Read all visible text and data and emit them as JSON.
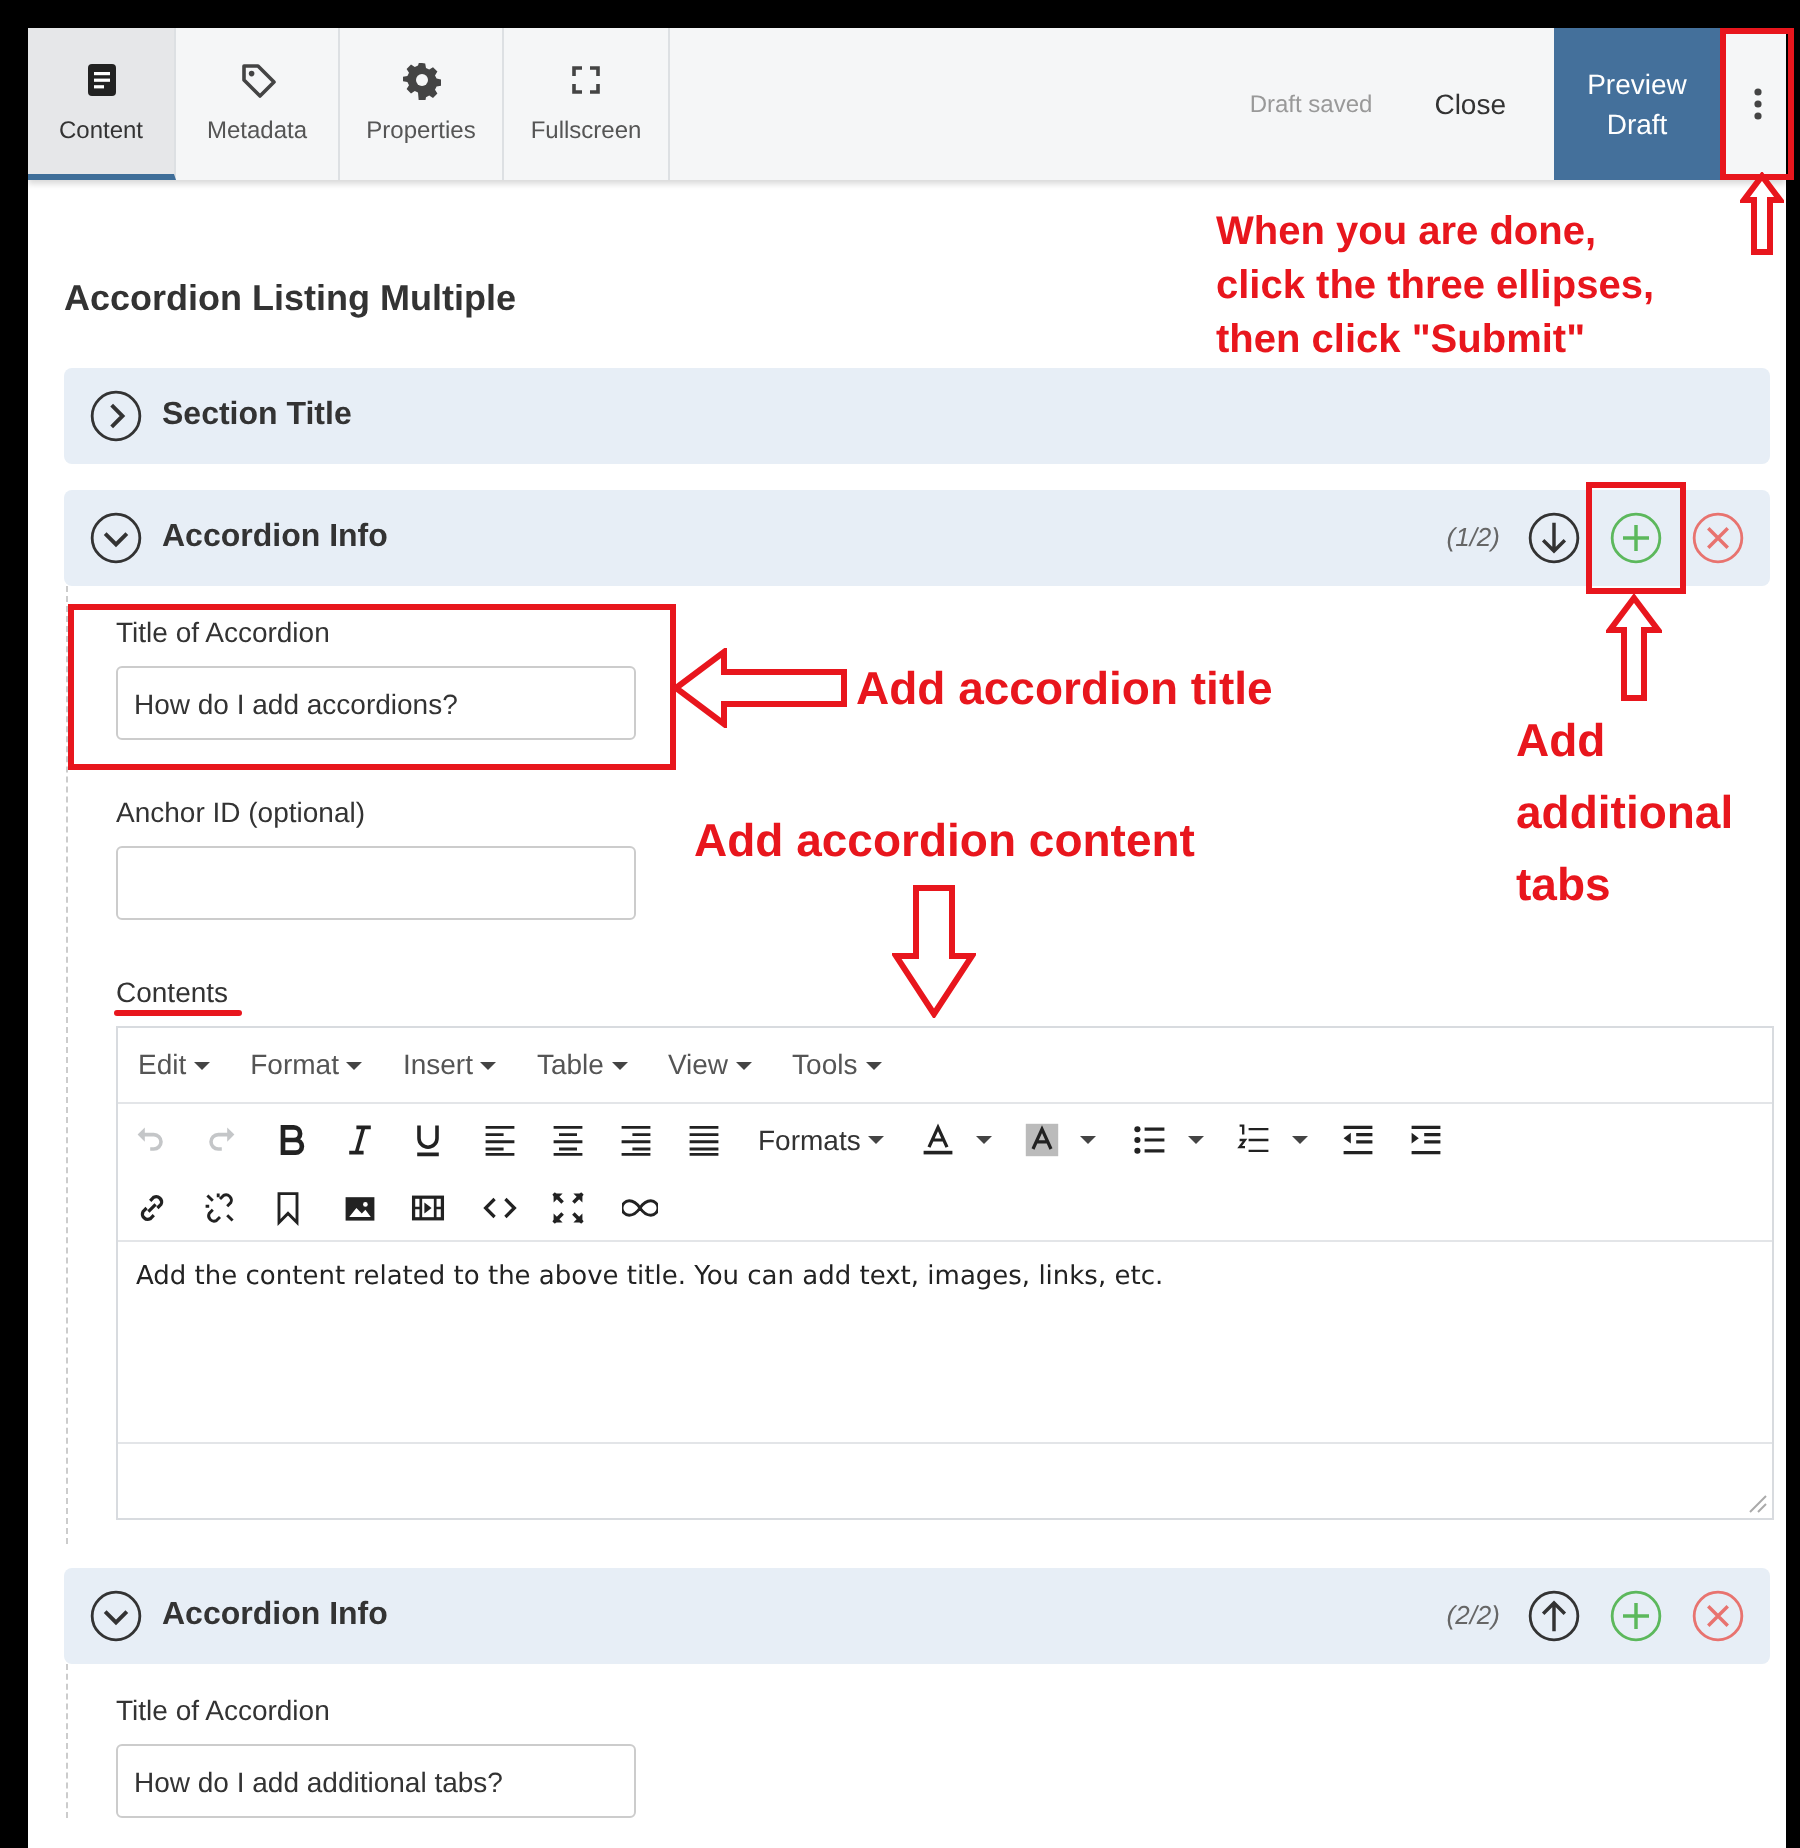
{
  "header": {
    "tabs": [
      {
        "label": "Content",
        "selected": true
      },
      {
        "label": "Metadata",
        "selected": false
      },
      {
        "label": "Properties",
        "selected": false
      },
      {
        "label": "Fullscreen",
        "selected": false
      }
    ],
    "status": "Draft saved",
    "close": "Close",
    "preview": "Preview Draft"
  },
  "page_title": "Accordion Listing Multiple",
  "sections": [
    {
      "title": "Section Title",
      "expanded": false
    },
    {
      "title": "Accordion Info",
      "expanded": true,
      "counter": "(1/2)",
      "move_down": true,
      "fields": [
        {
          "kind": "input",
          "label": "Title of Accordion",
          "value": "How do I add accordions?"
        },
        {
          "kind": "input",
          "label": "Anchor ID (optional)"
        },
        {
          "kind": "editor",
          "label": "Contents"
        }
      ]
    },
    {
      "title": "Accordion Info",
      "expanded": true,
      "counter": "(2/2)",
      "move_down": false,
      "fields": [
        {
          "kind": "input",
          "label": "Title of Accordion",
          "value": "How do I add additional tabs?"
        }
      ]
    }
  ],
  "editor": {
    "menus": [
      "Edit",
      "Format",
      "Insert",
      "Table",
      "View",
      "Tools"
    ],
    "toolbar_rows": [
      [
        [
          {
            "kind": "button",
            "disabled": true
          },
          {
            "kind": "button",
            "disabled": true
          }
        ],
        [
          {
            "kind": "button",
            "disabled": false
          },
          {
            "kind": "button",
            "disabled": false
          },
          {
            "kind": "button",
            "disabled": false
          }
        ],
        [
          {
            "kind": "button",
            "disabled": false
          },
          {
            "kind": "button",
            "disabled": false
          },
          {
            "kind": "button",
            "disabled": false
          },
          {
            "kind": "button",
            "disabled": false
          }
        ],
        [
          {
            "kind": "dropdown",
            "label": "Formats"
          }
        ],
        [
          {
            "kind": "split",
            "disabled": false
          },
          {
            "kind": "split",
            "disabled": false
          }
        ],
        [
          {
            "kind": "split",
            "disabled": false
          },
          {
            "kind": "split",
            "disabled": false
          },
          {
            "kind": "button",
            "disabled": false
          },
          {
            "kind": "button",
            "disabled": false
          }
        ]
      ],
      [
        [
          {
            "kind": "button",
            "disabled": false
          },
          {
            "kind": "button",
            "disabled": false
          },
          {
            "kind": "button",
            "disabled": false
          }
        ],
        [
          {
            "kind": "button",
            "disabled": false
          },
          {
            "kind": "button",
            "disabled": false
          }
        ],
        [
          {
            "kind": "button",
            "disabled": false
          },
          {
            "kind": "button",
            "disabled": false
          }
        ],
        [
          {
            "kind": "button",
            "disabled": false
          }
        ]
      ]
    ],
    "content": "Add the content related to the above title. You can add text, images, links, etc."
  },
  "annotations": [
    {
      "text": "When you are done, click the three ellipses, then click \"Submit\""
    },
    {
      "text": "Add accordion title"
    },
    {
      "text": "Add additional tabs"
    },
    {
      "text": "Add accordion content"
    }
  ]
}
